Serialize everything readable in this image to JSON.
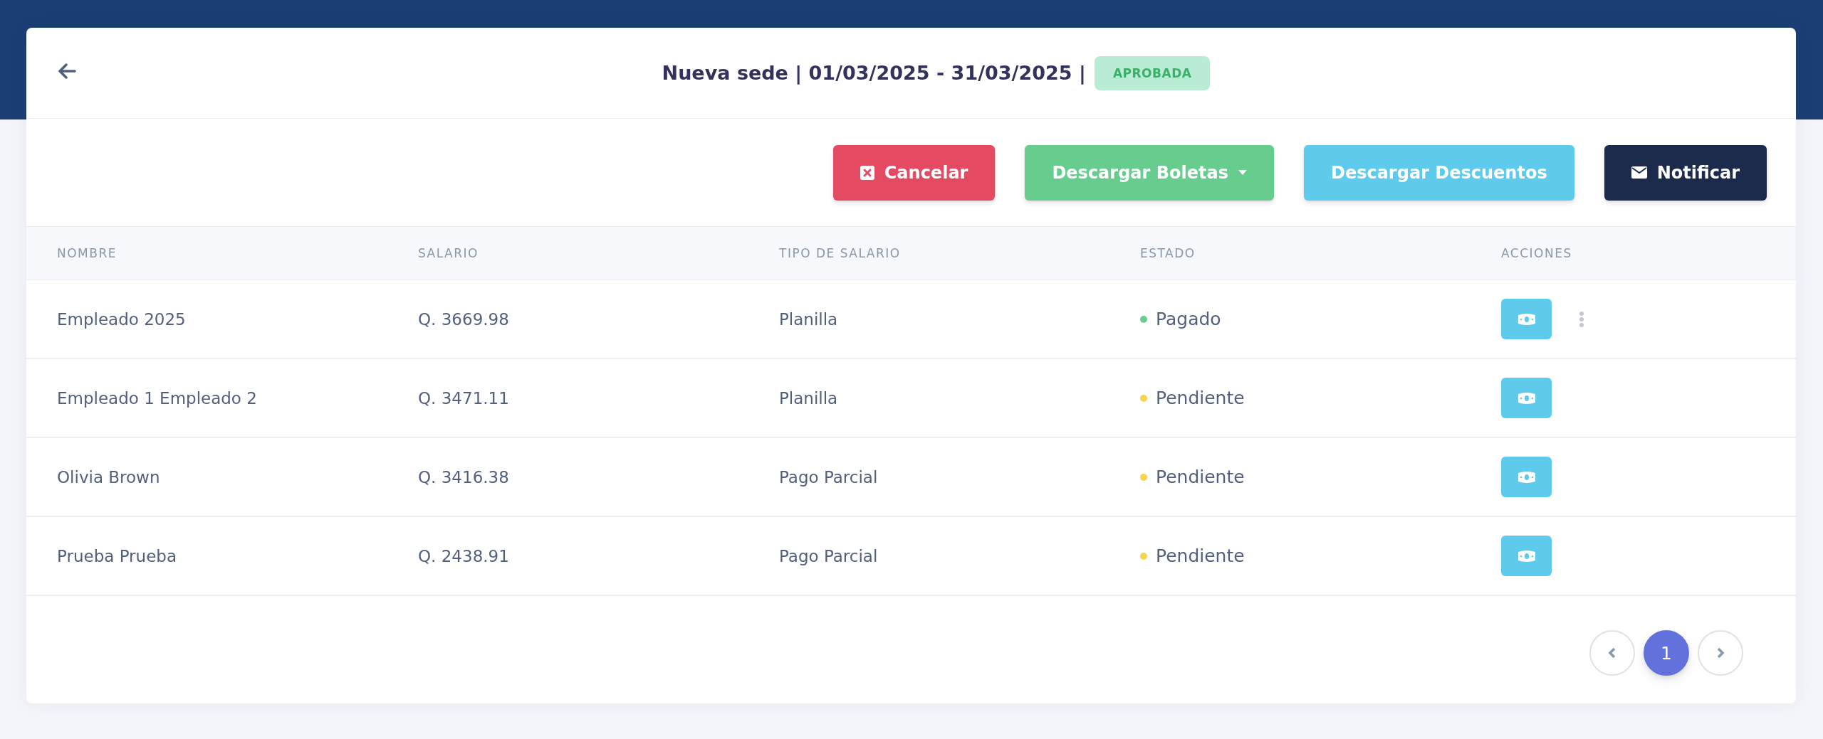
{
  "header": {
    "title": "Nueva sede | 01/03/2025 - 31/03/2025 |",
    "badge": "APROBADA"
  },
  "toolbar": [
    {
      "label": "Cancelar",
      "kind": "cancel"
    },
    {
      "label": "Descargar Boletas",
      "kind": "dropdown"
    },
    {
      "label": "Descargar Descuentos",
      "kind": "download"
    },
    {
      "label": "Notificar",
      "kind": "notify"
    }
  ],
  "table": {
    "columns": [
      "NOMBRE",
      "SALARIO",
      "TIPO DE SALARIO",
      "ESTADO",
      "ACCIONES"
    ],
    "rows": [
      {
        "name": "Empleado 2025",
        "salary": "Q. 3669.98",
        "type": "Planilla",
        "status": "Pagado",
        "color": "#68cd8e",
        "menu": true
      },
      {
        "name": "Empleado 1 Empleado 2",
        "salary": "Q. 3471.11",
        "type": "Planilla",
        "status": "Pendiente",
        "color": "#f7d54a",
        "menu": false
      },
      {
        "name": "Olivia Brown",
        "salary": "Q. 3416.38",
        "type": "Pago Parcial",
        "status": "Pendiente",
        "color": "#f7d54a",
        "menu": false
      },
      {
        "name": "Prueba Prueba",
        "salary": "Q. 2438.91",
        "type": "Pago Parcial",
        "status": "Pendiente",
        "color": "#f7d54a",
        "menu": false
      }
    ]
  },
  "pagination": {
    "pages": [
      {
        "label": "1",
        "selected": true
      }
    ]
  }
}
